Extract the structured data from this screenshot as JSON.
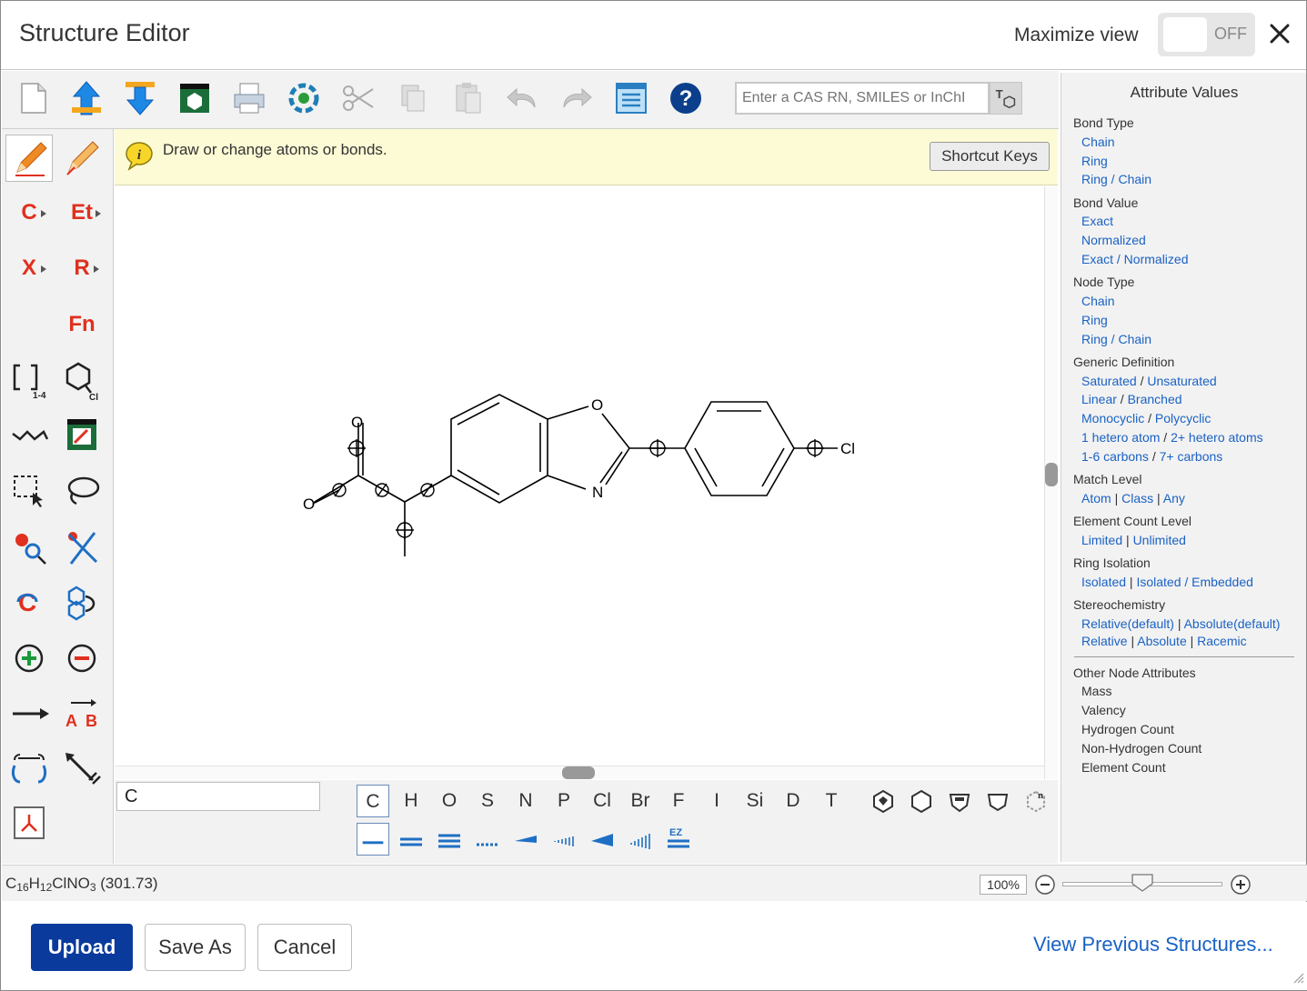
{
  "header": {
    "title": "Structure Editor",
    "maximize_label": "Maximize view",
    "toggle_state": "OFF"
  },
  "toolbar": {
    "icons": [
      "new-document-icon",
      "open-file-icon",
      "save-file-icon",
      "template-icon",
      "print-icon",
      "clean-structure-icon",
      "cut-icon",
      "copy-icon",
      "paste-icon",
      "undo-icon",
      "redo-icon",
      "list-view-icon",
      "help-icon"
    ],
    "cas_placeholder": "Enter a CAS RN, SMILES or InChI"
  },
  "info": {
    "message": "Draw or change atoms or bonds.",
    "shortcut_label": "Shortcut Keys"
  },
  "left_tools": {
    "carbon": "C",
    "ethyl": "Et",
    "halogen": "X",
    "rgroup": "R",
    "function": "Fn",
    "bracket_sub": "1-4",
    "ring_sub": "Cl"
  },
  "palette": {
    "atom_value": "C",
    "elements": [
      "C",
      "H",
      "O",
      "S",
      "N",
      "P",
      "Cl",
      "Br",
      "F",
      "I",
      "Si",
      "D",
      "T"
    ],
    "selected_element": "C",
    "template_last": "n"
  },
  "molecule": {
    "atoms": {
      "O_top": "O",
      "O_left": "O",
      "O_ring": "O",
      "N_ring": "N",
      "Cl": "Cl"
    }
  },
  "attributes": {
    "title": "Attribute Values",
    "bond_type": {
      "heading": "Bond Type",
      "items": [
        "Chain",
        "Ring",
        "Ring / Chain"
      ]
    },
    "bond_value": {
      "heading": "Bond Value",
      "items": [
        "Exact",
        "Normalized",
        "Exact / Normalized"
      ]
    },
    "node_type": {
      "heading": "Node Type",
      "items": [
        "Chain",
        "Ring",
        "Ring / Chain"
      ]
    },
    "generic": {
      "heading": "Generic Definition",
      "rows": [
        [
          "Saturated",
          "Unsaturated"
        ],
        [
          "Linear",
          "Branched"
        ],
        [
          "Monocyclic",
          "Polycyclic"
        ],
        [
          "1 hetero atom",
          "2+ hetero atoms"
        ],
        [
          "1-6 carbons",
          "7+ carbons"
        ]
      ]
    },
    "match_level": {
      "heading": "Match Level",
      "items": [
        "Atom",
        "Class",
        "Any"
      ]
    },
    "element_count": {
      "heading": "Element Count Level",
      "items": [
        "Limited",
        "Unlimited"
      ]
    },
    "ring_isolation": {
      "heading": "Ring Isolation",
      "items": [
        "Isolated",
        "Isolated / Embedded"
      ]
    },
    "stereo": {
      "heading": "Stereochemistry",
      "row1": [
        "Relative(default)",
        "Absolute(default)"
      ],
      "row2": [
        "Relative",
        "Absolute",
        "Racemic"
      ]
    },
    "other": {
      "heading": "Other Node Attributes",
      "items": [
        "Mass",
        "Valency",
        "Hydrogen Count",
        "Non-Hydrogen Count",
        "Element Count"
      ]
    }
  },
  "status": {
    "formula_parts": [
      "C",
      "16",
      "H",
      "12",
      "ClNO",
      "3"
    ],
    "mass": " (301.73)",
    "zoom": "100%"
  },
  "footer": {
    "upload": "Upload",
    "save_as": "Save As",
    "cancel": "Cancel",
    "view_previous": "View Previous Structures..."
  }
}
